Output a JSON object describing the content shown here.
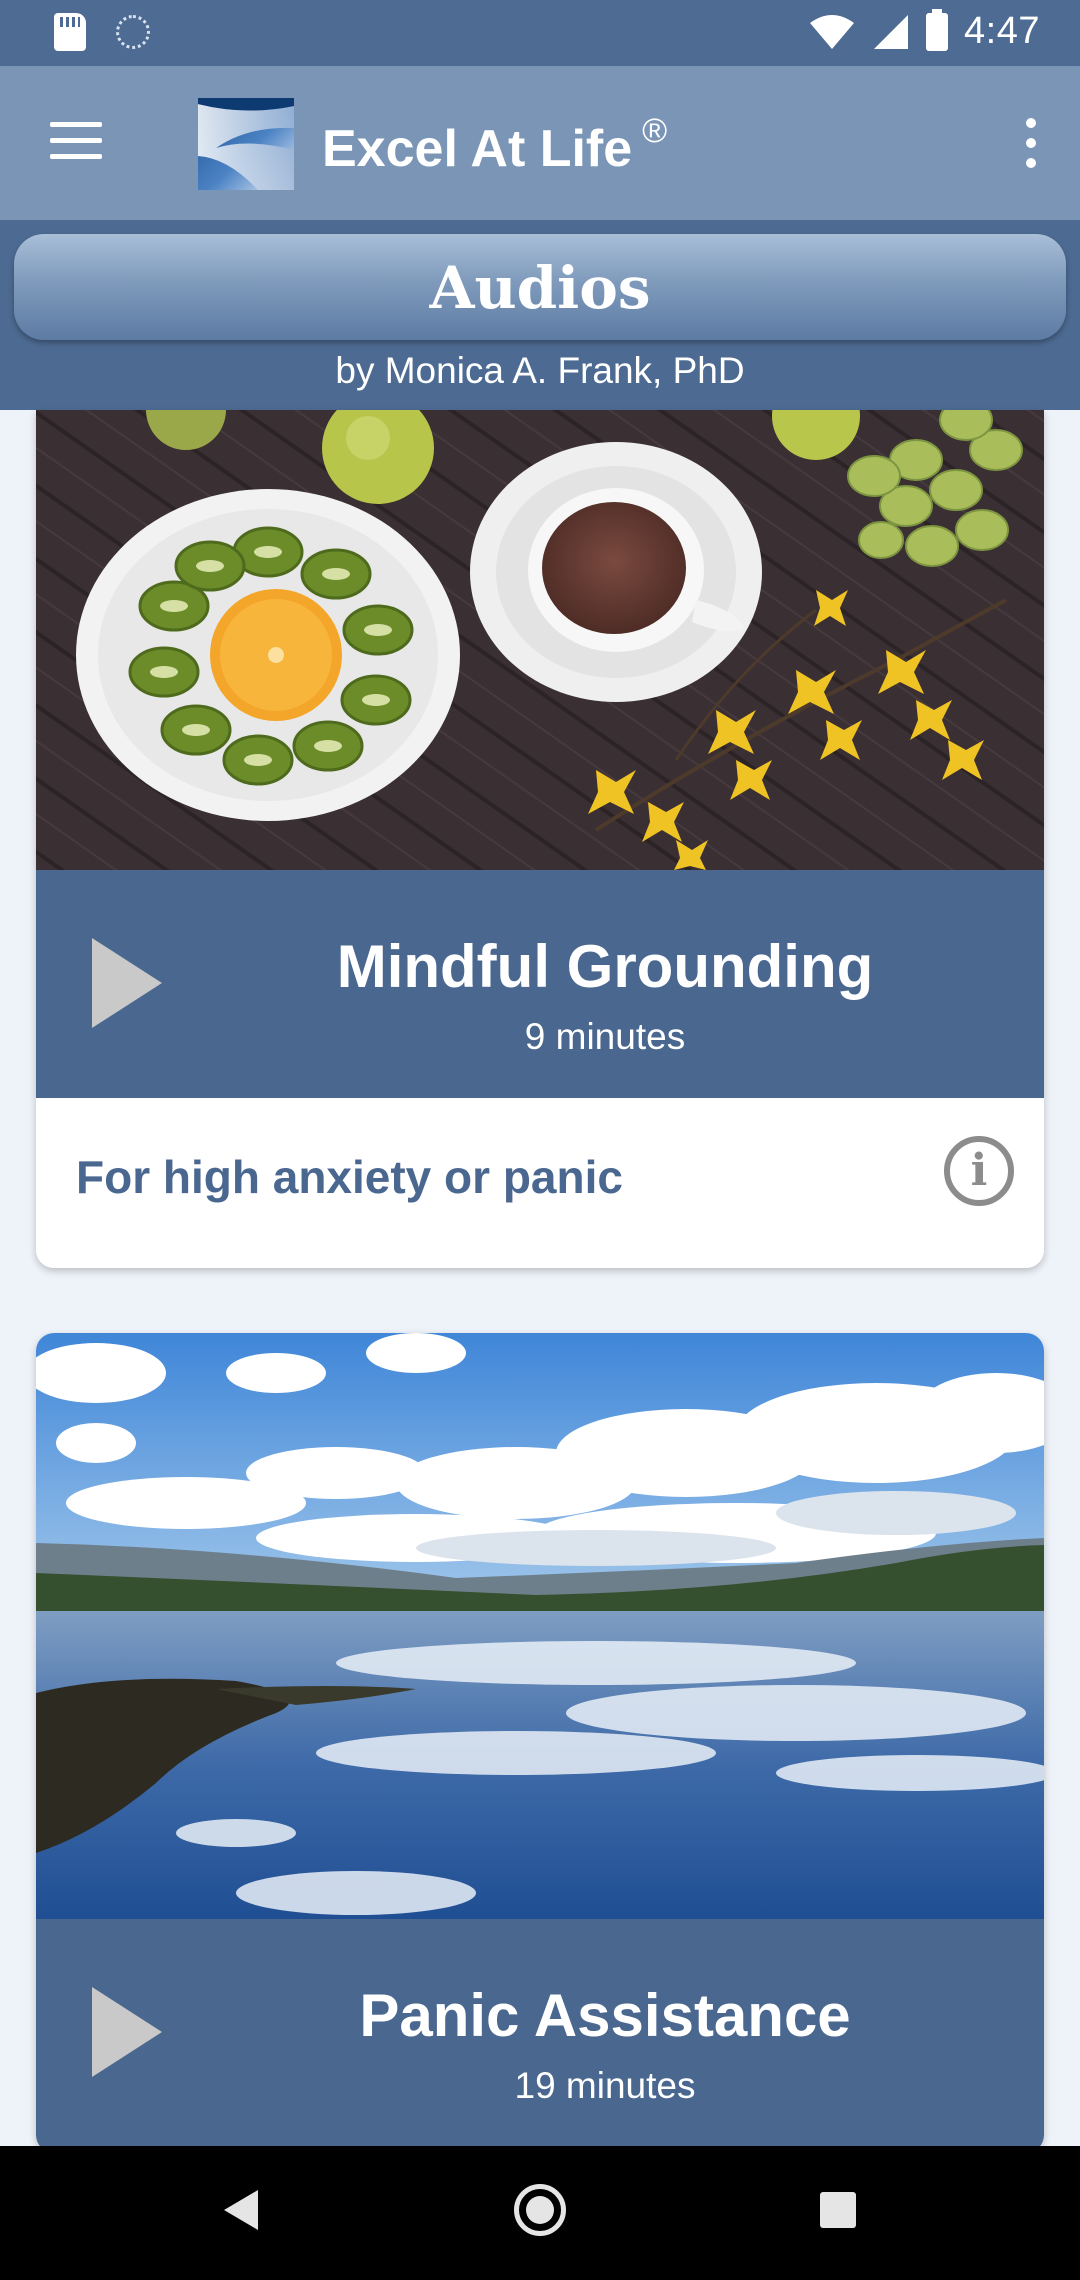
{
  "status_bar": {
    "time": "4:47"
  },
  "app_bar": {
    "title": "Excel At Life",
    "registered_mark": "®"
  },
  "header": {
    "title": "Audios",
    "byline": "by Monica A. Frank, PhD"
  },
  "cards": [
    {
      "image": "fruit-and-tea-photo",
      "title": "Mindful Grounding",
      "duration": "9 minutes",
      "description": "For high anxiety or panic",
      "info_symbol": "i"
    },
    {
      "image": "lake-landscape-photo",
      "title": "Panic Assistance",
      "duration": "19 minutes"
    }
  ],
  "colors": {
    "status_bar": "#4e6b93",
    "app_bar": "#7a95b6",
    "header_panel": "#4d6b92",
    "play_band": "#4a6790",
    "description_text": "#4a6790",
    "page_background": "#eef3f9"
  }
}
